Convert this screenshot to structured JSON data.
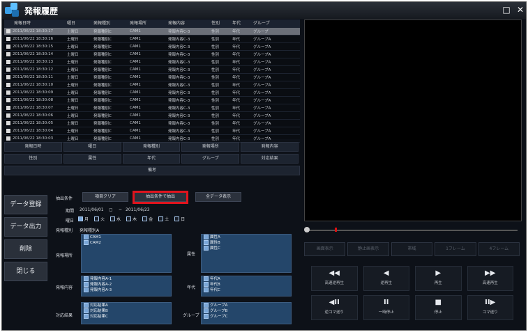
{
  "window": {
    "title": "発報履歴",
    "btn_restore": "□",
    "btn_close": "✕"
  },
  "table": {
    "headers": [
      "発報日時",
      "曜日",
      "発報種別",
      "発報場所",
      "発報内容",
      "性別",
      "年代",
      "グループ"
    ],
    "rows": [
      [
        "2011/06/22 18:30:17",
        "土曜日",
        "発報種別C",
        "CAM1",
        "発報内容C-3",
        "性別",
        "年代",
        "グループ"
      ],
      [
        "2011/06/22 18:30:16",
        "土曜日",
        "発報種別C",
        "CAM1",
        "発報内容C-3",
        "性別",
        "年代",
        "グループA"
      ],
      [
        "2011/06/22 18:30:15",
        "土曜日",
        "発報種別C",
        "CAM1",
        "発報内容C-3",
        "性別",
        "年代",
        "グループA"
      ],
      [
        "2011/06/22 18:30:14",
        "土曜日",
        "発報種別C",
        "CAM1",
        "発報内容C-3",
        "性別",
        "年代",
        "グループA"
      ],
      [
        "2011/06/22 18:30:13",
        "土曜日",
        "発報種別C",
        "CAM1",
        "発報内容C-3",
        "性別",
        "年代",
        "グループA"
      ],
      [
        "2011/06/22 18:30:12",
        "土曜日",
        "発報種別C",
        "CAM1",
        "発報内容C-3",
        "性別",
        "年代",
        "グループA"
      ],
      [
        "2011/06/22 18:30:11",
        "土曜日",
        "発報種別C",
        "CAM1",
        "発報内容C-3",
        "性別",
        "年代",
        "グループA"
      ],
      [
        "2011/06/22 18:30:10",
        "土曜日",
        "発報種別C",
        "CAM1",
        "発報内容C-3",
        "性別",
        "年代",
        "グループA"
      ],
      [
        "2011/06/22 18:30:09",
        "土曜日",
        "発報種別C",
        "CAM1",
        "発報内容C-3",
        "性別",
        "年代",
        "グループA"
      ],
      [
        "2011/06/22 18:30:08",
        "土曜日",
        "発報種別C",
        "CAM1",
        "発報内容C-3",
        "性別",
        "年代",
        "グループA"
      ],
      [
        "2011/06/22 18:30:07",
        "土曜日",
        "発報種別C",
        "CAM1",
        "発報内容C-3",
        "性別",
        "年代",
        "グループA"
      ],
      [
        "2011/06/22 18:30:06",
        "土曜日",
        "発報種別C",
        "CAM1",
        "発報内容C-3",
        "性別",
        "年代",
        "グループA"
      ],
      [
        "2011/06/22 18:30:05",
        "土曜日",
        "発報種別C",
        "CAM1",
        "発報内容C-3",
        "性別",
        "年代",
        "グループA"
      ],
      [
        "2011/06/22 18:30:04",
        "土曜日",
        "発報種別C",
        "CAM1",
        "発報内容C-3",
        "性別",
        "年代",
        "グループA"
      ],
      [
        "2011/06/22 18:30:03",
        "土曜日",
        "発報種別C",
        "CAM1",
        "発報内容C-3",
        "性別",
        "年代",
        "グループA"
      ]
    ]
  },
  "sort_buttons": {
    "row1": [
      "発報日時",
      "曜日",
      "発報種別",
      "発報場所",
      "発報内容"
    ],
    "row2": [
      "性別",
      "属性",
      "年代",
      "グループ",
      "対応結果"
    ],
    "row3": "備考"
  },
  "side": [
    "データ登録",
    "データ出力",
    "削除",
    "閉じる"
  ],
  "filter": {
    "cond_label": "抽出条件",
    "btn_clear": "項目クリア",
    "btn_search": "抽出条件で抽出",
    "btn_all": "全データ表示",
    "period_label": "期間",
    "period_from": "2011/06/01",
    "period_sep": "~",
    "period_to": "2011/06/23",
    "weekday_label": "曜日",
    "weekdays": [
      "月",
      "火",
      "水",
      "木",
      "金",
      "土",
      "日"
    ],
    "type_label": "発報種別",
    "type_value": "発報種別A",
    "place_label": "発報場所",
    "place_items": [
      "CAM1",
      "CAM2"
    ],
    "attr_label": "属性",
    "attr_items": [
      "属性A",
      "属性B",
      "属性C"
    ],
    "content_label": "発報内容",
    "content_items": [
      "発報内容A-1",
      "発報内容A-2",
      "発報内容A-3"
    ],
    "age_label": "年代",
    "age_items": [
      "年代A",
      "年代B",
      "年代C"
    ],
    "result_label": "対応結果",
    "result_items": [
      "対応結果A",
      "対応結果B",
      "対応結果C"
    ],
    "group_label": "グループ",
    "group_items": [
      "グループA",
      "グループB",
      "グループC"
    ]
  },
  "player": {
    "modes": [
      "画面表示",
      "静止画表示",
      "帯域",
      "1フレーム",
      "4フレーム"
    ],
    "buttons": [
      {
        "glyph": "◀◀",
        "caption": "高速逆再生"
      },
      {
        "glyph": "◀",
        "caption": "逆再生"
      },
      {
        "glyph": "▶",
        "caption": "再生"
      },
      {
        "glyph": "▶▶",
        "caption": "高速再生"
      },
      {
        "glyph": "◀II",
        "caption": "逆コマ送り"
      },
      {
        "glyph": "II",
        "caption": "一時停止"
      },
      {
        "glyph": "■",
        "caption": "停止"
      },
      {
        "glyph": "II▶",
        "caption": "コマ送り"
      }
    ]
  },
  "colors": {
    "highlight": "#e0141e",
    "list_bg": "#24466a",
    "accent": "#3aa0e8"
  }
}
